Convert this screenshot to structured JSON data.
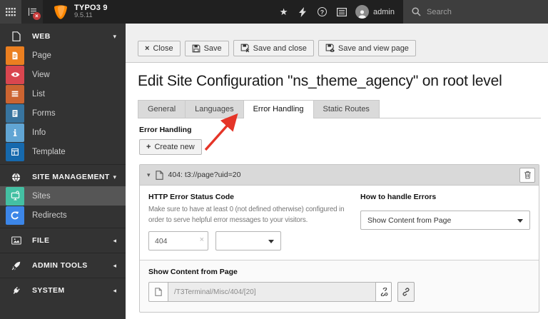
{
  "colors": {
    "brand_orange": "#ff8700",
    "topbar_bg": "#202020",
    "sidebar_bg": "#333333",
    "active_item_bg": "#565656",
    "annotation_arrow_red": "#e53528",
    "module_page": "#eb7f20",
    "module_view": "#d9464f",
    "module_list": "#cc6431",
    "module_forms": "#38749f",
    "module_info": "#61a5d4",
    "module_template": "#1669ad",
    "module_sites": "#44c0a3",
    "module_redirects": "#3c86e8"
  },
  "icons": {
    "chevron_down": "▾",
    "chevron_left": "◂",
    "close_x": "×",
    "plus": "+",
    "star": "★",
    "question": "?",
    "badge_x": "×",
    "clear_x": "×"
  },
  "topbar": {
    "product": "TYPO3 9",
    "version": "9.5.11",
    "user": "admin",
    "search_placeholder": "Search"
  },
  "sidebar": {
    "sections": [
      {
        "label": "WEB",
        "expanded": true,
        "items": [
          {
            "label": "Page"
          },
          {
            "label": "View"
          },
          {
            "label": "List"
          },
          {
            "label": "Forms"
          },
          {
            "label": "Info"
          },
          {
            "label": "Template"
          }
        ]
      },
      {
        "label": "SITE MANAGEMENT",
        "expanded": true,
        "items": [
          {
            "label": "Sites",
            "active": true
          },
          {
            "label": "Redirects"
          }
        ]
      },
      {
        "label": "FILE",
        "expanded": false,
        "items": []
      },
      {
        "label": "ADMIN TOOLS",
        "expanded": false,
        "items": []
      },
      {
        "label": "SYSTEM",
        "expanded": false,
        "items": []
      }
    ]
  },
  "docheader": {
    "close": "Close",
    "save": "Save",
    "save_close": "Save and close",
    "save_view": "Save and view page"
  },
  "page": {
    "title": "Edit Site Configuration \"ns_theme_agency\" on root level"
  },
  "tabs": [
    {
      "label": "General"
    },
    {
      "label": "Languages"
    },
    {
      "label": "Error Handling",
      "active": true
    },
    {
      "label": "Static Routes"
    }
  ],
  "error_handling": {
    "heading": "Error Handling",
    "create_button": "Create new",
    "panel": {
      "title": "404: t3://page?uid=20",
      "http_code": {
        "label": "HTTP Error Status Code",
        "description": "Make sure to have at least 0 (not defined otherwise) configured in order to serve helpful error messages to your visitors.",
        "value": "404"
      },
      "handler": {
        "label": "How to handle Errors",
        "value": "Show Content from Page"
      },
      "content_page": {
        "label": "Show Content from Page",
        "value": "/T3Terminal/Misc/404/[20]"
      }
    }
  }
}
